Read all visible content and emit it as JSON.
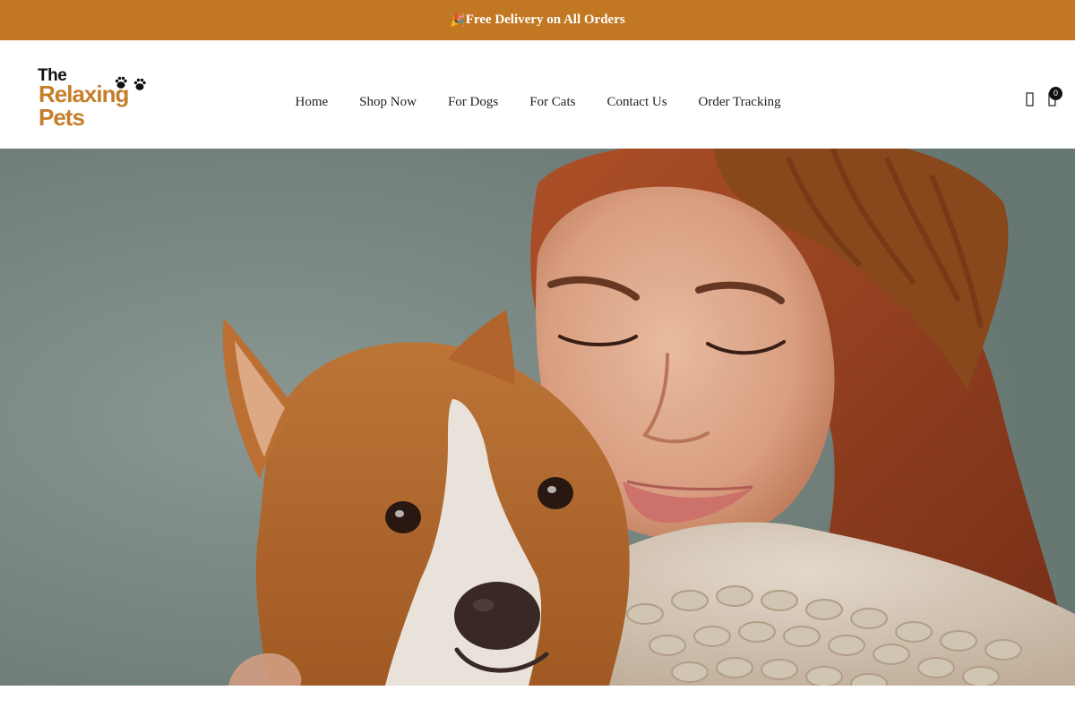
{
  "announcement": {
    "emoji": "🎉",
    "text": "Free Delivery on All Orders",
    "background": "#c27722"
  },
  "logo": {
    "line1": "The",
    "line2": "Relaxing",
    "line3": "Pets",
    "accent_color": "#c57f2a",
    "icon": "paw-prints-icon"
  },
  "nav": {
    "items": [
      {
        "label": "Home"
      },
      {
        "label": "Shop Now"
      },
      {
        "label": "For Dogs"
      },
      {
        "label": "For Cats"
      },
      {
        "label": "Contact Us"
      },
      {
        "label": "Order Tracking"
      }
    ]
  },
  "header_icons": {
    "search_icon": "search-icon",
    "cart_icon": "shopping-bag-icon",
    "cart_count": "0"
  },
  "hero": {
    "image": "woman-hugging-corgi-photo"
  }
}
